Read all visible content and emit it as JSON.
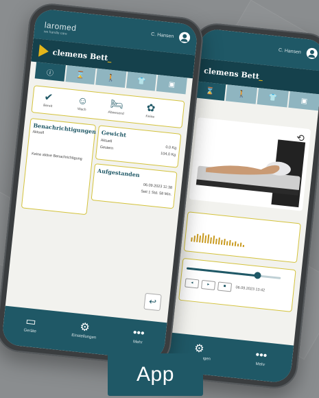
{
  "colors": {
    "brand_teal": "#1f5866",
    "accent_yellow": "#e4b61a",
    "panel_border": "#d3c23a"
  },
  "front": {
    "logo": "laromed",
    "logo_sub": "we handle care",
    "user": "C. Hansen",
    "bed_name": "clemens Bett",
    "tabs": [
      {
        "icon": "info-icon",
        "glyph": "ⓘ"
      },
      {
        "icon": "hourglass-icon",
        "glyph": "⌛"
      },
      {
        "icon": "walking-icon",
        "glyph": "🚶"
      },
      {
        "icon": "person-icon",
        "glyph": "👕"
      },
      {
        "icon": "screen-icon",
        "glyph": "▣"
      }
    ],
    "status": [
      {
        "label": "Bereit",
        "glyph": "✔"
      },
      {
        "label": "Wach",
        "glyph": "☺"
      },
      {
        "label": "Abwesend",
        "glyph": "🛏"
      },
      {
        "label": "Keine",
        "glyph": "✿"
      }
    ],
    "notifications": {
      "title": "Benachrichtigungen",
      "current_label": "Aktuell",
      "empty": "Keine aktive Benachrichtigung"
    },
    "weight": {
      "title": "Gewicht",
      "current_label": "Aktuell",
      "current_value": "0,0 Kg",
      "yesterday_label": "Gestern",
      "yesterday_value": "104,0 Kg"
    },
    "up": {
      "title": "Aufgestanden",
      "date": "06.09.2023 11:38",
      "since": "Seit 1 Std. 58 Min."
    },
    "nav": [
      {
        "label": "Geräte",
        "glyph": "▭"
      },
      {
        "label": "Einstellungen",
        "glyph": "⚙"
      },
      {
        "label": "Mehr",
        "glyph": "•••"
      }
    ],
    "back_glyph": "↩"
  },
  "back": {
    "user": "C. Hansen",
    "bed_name": "clemens Bett",
    "timestamp": "06.09.2023 13:42",
    "rotate_glyph": "⟲",
    "nav": [
      {
        "label": "Einstellungen",
        "glyph": "⚙"
      },
      {
        "label": "Mehr",
        "glyph": "•••"
      }
    ],
    "controls": [
      "◂",
      "▸",
      "■"
    ],
    "slider_fraction": 0.75
  },
  "badge": {
    "label": "App"
  }
}
